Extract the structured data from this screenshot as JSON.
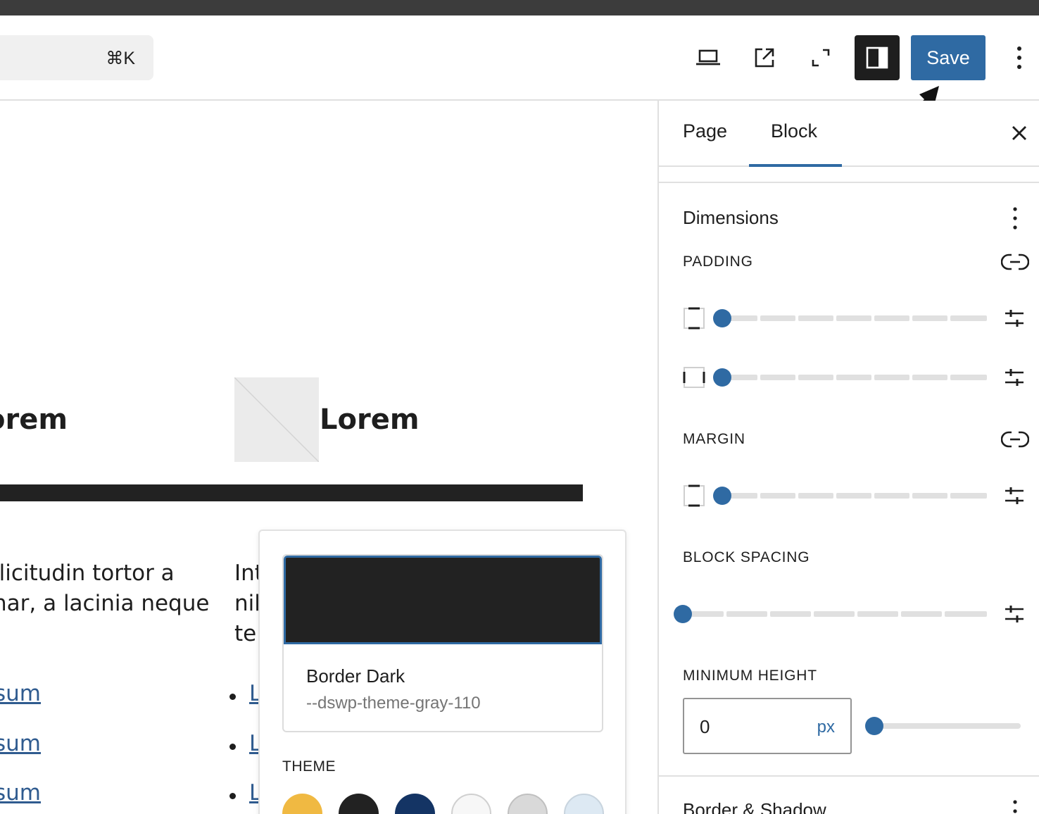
{
  "header": {
    "command_hint": "⌘K",
    "save_label": "Save",
    "icons": [
      "laptop-icon",
      "external-link-icon",
      "fullscreen-icon",
      "sidebar-toggle-icon",
      "more-vertical-icon"
    ]
  },
  "canvas": {
    "heading_left": "orem",
    "heading_right": "Lorem",
    "para_left": [
      "llicitudin tortor a",
      "nar, a lacinia neque"
    ],
    "para_right": [
      "Int",
      "nil",
      "ter"
    ],
    "links_left": [
      "sum",
      "sum",
      "sum"
    ],
    "links_right": [
      "L",
      "L",
      "L"
    ]
  },
  "popover": {
    "color_name": "Border Dark",
    "color_var": "--dswp-theme-gray-110",
    "selected_color": "#222222",
    "theme_label": "THEME",
    "theme_colors": [
      "#f0b942",
      "#222222",
      "#143464",
      "#f7f7f7",
      "#d9d9d9",
      "#dde9f3"
    ]
  },
  "sidebar": {
    "tabs": [
      "Page",
      "Block"
    ],
    "active_tab": "Block",
    "panel_title": "Dimensions",
    "padding_label": "PADDING",
    "margin_label": "MARGIN",
    "block_spacing_label": "BLOCK SPACING",
    "min_height_label": "MINIMUM HEIGHT",
    "min_height_value": "0",
    "min_height_unit": "px",
    "next_panel_title": "Border & Shadow",
    "accent_color": "#2f6aa3"
  }
}
